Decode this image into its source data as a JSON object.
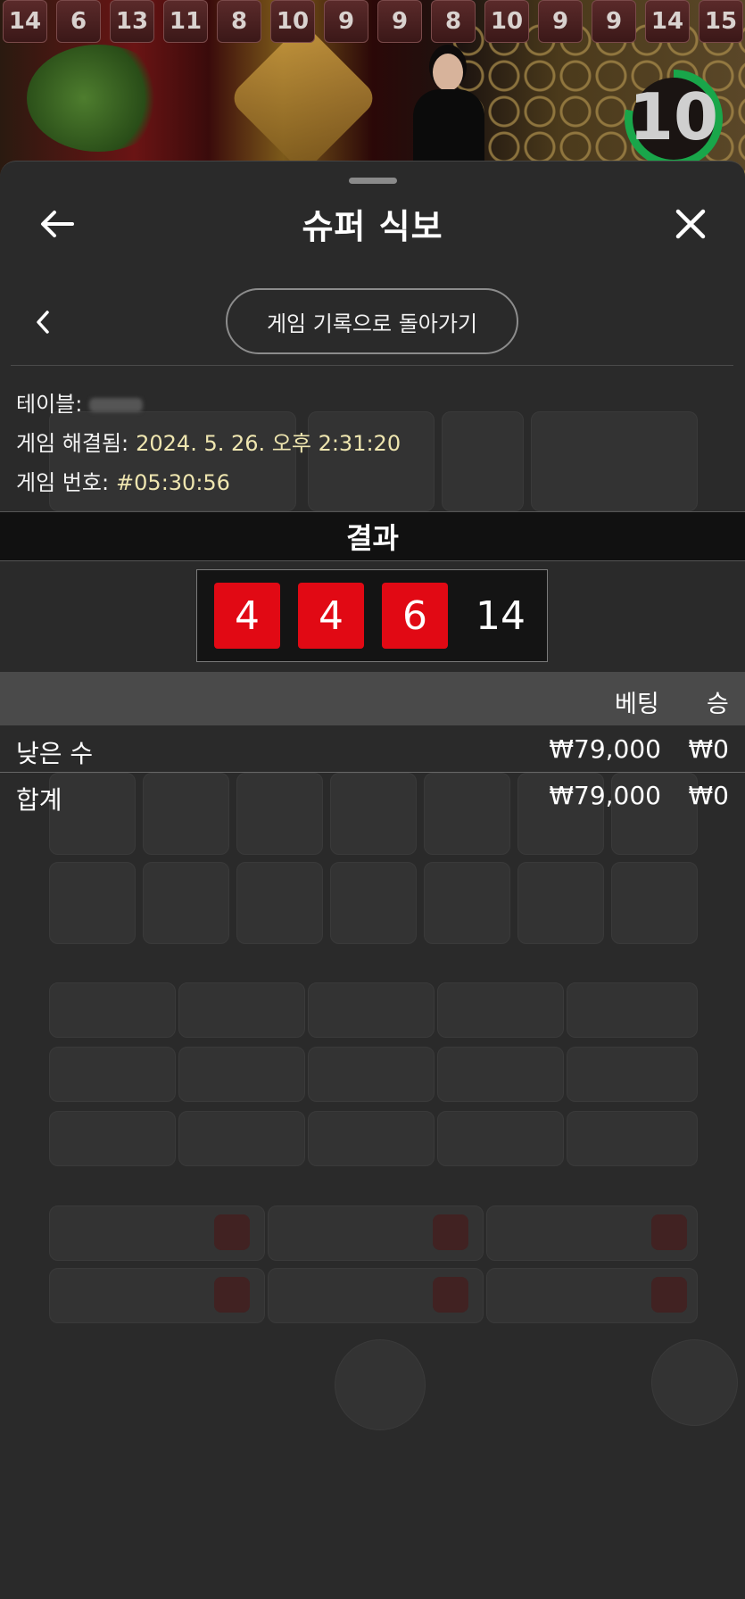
{
  "history": [
    "14",
    "6",
    "13",
    "11",
    "8",
    "10",
    "9",
    "9",
    "8",
    "10",
    "9",
    "9",
    "14",
    "15"
  ],
  "timer": {
    "value": "10",
    "progress": 0.78,
    "color": "#19a64a"
  },
  "sheet": {
    "title": "슈퍼 식보",
    "history_back_label": "게임 기록으로 돌아가기"
  },
  "info": {
    "table_label": "테이블:",
    "resolved_label": "게임 해결됨:",
    "resolved_value": "2024. 5. 26. 오후 2:31:20",
    "game_no_label": "게임 번호:",
    "game_no_value": "#05:30:56"
  },
  "result": {
    "header": "결과",
    "dice": [
      "4",
      "4",
      "6"
    ],
    "total": "14",
    "dice_color": "#e10914"
  },
  "bets": {
    "col_bet": "베팅",
    "col_win": "승",
    "rows": [
      {
        "name": "낮은 수",
        "bet": "₩79,000",
        "win": "₩0"
      }
    ],
    "total": {
      "name": "합계",
      "bet": "₩79,000",
      "win": "₩0"
    }
  },
  "colors": {
    "accent_value": "#efe6b0",
    "sheet_bg": "#2a2a2a"
  }
}
